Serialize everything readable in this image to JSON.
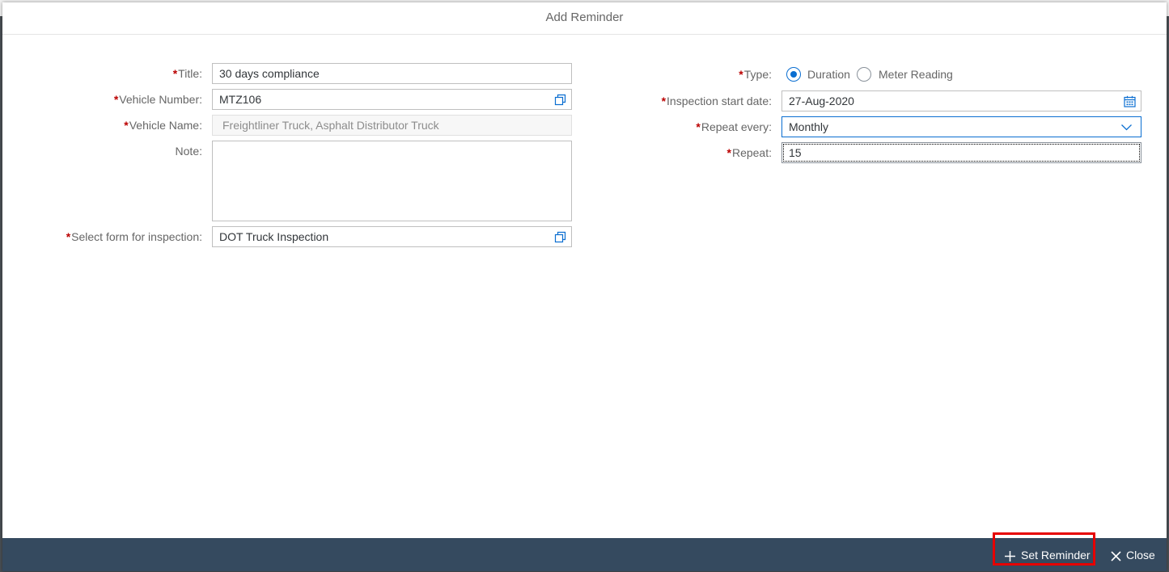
{
  "dialog": {
    "title": "Add Reminder"
  },
  "left_form": {
    "title": {
      "label": "Title:",
      "value": "30 days compliance"
    },
    "vehicle_number": {
      "label": "Vehicle Number:",
      "value": "MTZ106"
    },
    "vehicle_name": {
      "label": "Vehicle Name:",
      "value": "Freightliner  Truck, Asphalt Distributor Truck"
    },
    "note": {
      "label": "Note:",
      "value": ""
    },
    "inspection_form": {
      "label": "Select form for inspection:",
      "value": "DOT Truck Inspection"
    }
  },
  "right_form": {
    "type": {
      "label": "Type:",
      "options": [
        "Duration",
        "Meter Reading"
      ],
      "selected": "Duration"
    },
    "start_date": {
      "label": "Inspection start date:",
      "value": "27-Aug-2020"
    },
    "repeat_every": {
      "label": "Repeat every:",
      "value": "Monthly"
    },
    "repeat": {
      "label": "Repeat:",
      "value": "15"
    }
  },
  "required_marker": "*",
  "footer": {
    "set_reminder_label": "Set Reminder",
    "close_label": "Close"
  },
  "colors": {
    "accent": "#0a6ed1",
    "required": "#bb0000",
    "footer_bg": "#354a5f",
    "highlight_box": "#e60000"
  }
}
